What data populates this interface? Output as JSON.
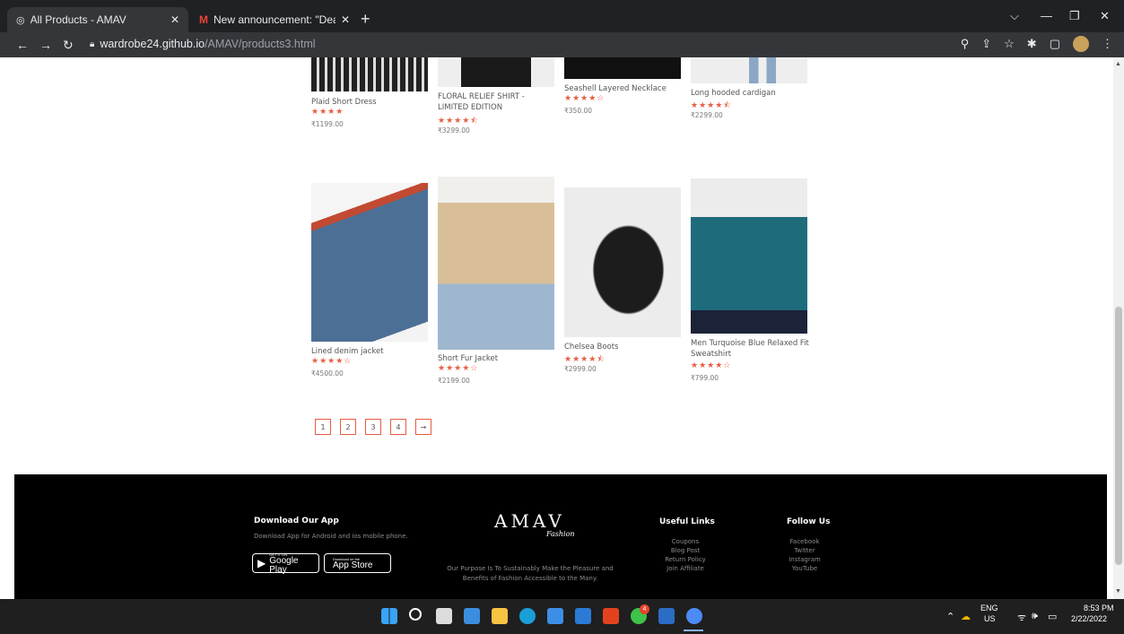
{
  "browser": {
    "tabs": [
      {
        "title": "All Products - AMAV",
        "active": true
      },
      {
        "title": "New announcement: \"Dear stude",
        "active": false
      }
    ],
    "close_glyph": "✕",
    "new_tab": "+",
    "url_host": "wardrobe24.github.io",
    "url_path": "/AMAV/products3.html"
  },
  "top_products": [
    {
      "name": "Plaid Short Dress",
      "stars": "★★★★",
      "price": "₹1199.00"
    },
    {
      "name": "FLORAL RELIEF SHIRT - LIMITED EDITION",
      "stars": "★★★★⯪",
      "price": "₹3299.00"
    },
    {
      "name": "Seashell Layered Necklace",
      "stars": "★★★★☆",
      "price": "₹350.00"
    },
    {
      "name": "Long hooded cardigan",
      "stars": "★★★★⯪",
      "price": "₹2299.00"
    }
  ],
  "products": [
    {
      "name": "Lined denim jacket",
      "stars": "★★★★☆",
      "price": "₹4500.00"
    },
    {
      "name": "Short Fur Jacket",
      "stars": "★★★★☆",
      "price": "₹2199.00"
    },
    {
      "name": "Chelsea Boots",
      "stars": "★★★★⯪",
      "price": "₹2999.00"
    },
    {
      "name": "Men Turquoise Blue Relaxed Fit Sweatshirt",
      "stars": "★★★★☆",
      "price": "₹799.00"
    }
  ],
  "pagination": [
    "1",
    "2",
    "3",
    "4",
    "→"
  ],
  "footer": {
    "app_heading": "Download Our App",
    "app_text": "Download App for Android and ios mobile phone.",
    "google_small": "GET IT ON",
    "google_big": "Google Play",
    "apple_small": "Download on the",
    "apple_big": "App Store",
    "logo": "AMAV",
    "logo_sub": "Fashion",
    "purpose": "Our Purpose Is To Sustainably Make the Pleasure and Benefits of Fashion Accessible to the Many.",
    "useful_heading": "Useful Links",
    "useful_links": [
      "Coupons",
      "Blog Post",
      "Return Policy",
      "Join Affiliate"
    ],
    "follow_heading": "Follow Us",
    "follow_links": [
      "Facebook",
      "Twitter",
      "Instagram",
      "YouTube"
    ]
  },
  "taskbar": {
    "lang": "ENG",
    "region": "US",
    "time": "8:53 PM",
    "date": "2/22/2022",
    "whatsapp_badge": "4"
  }
}
